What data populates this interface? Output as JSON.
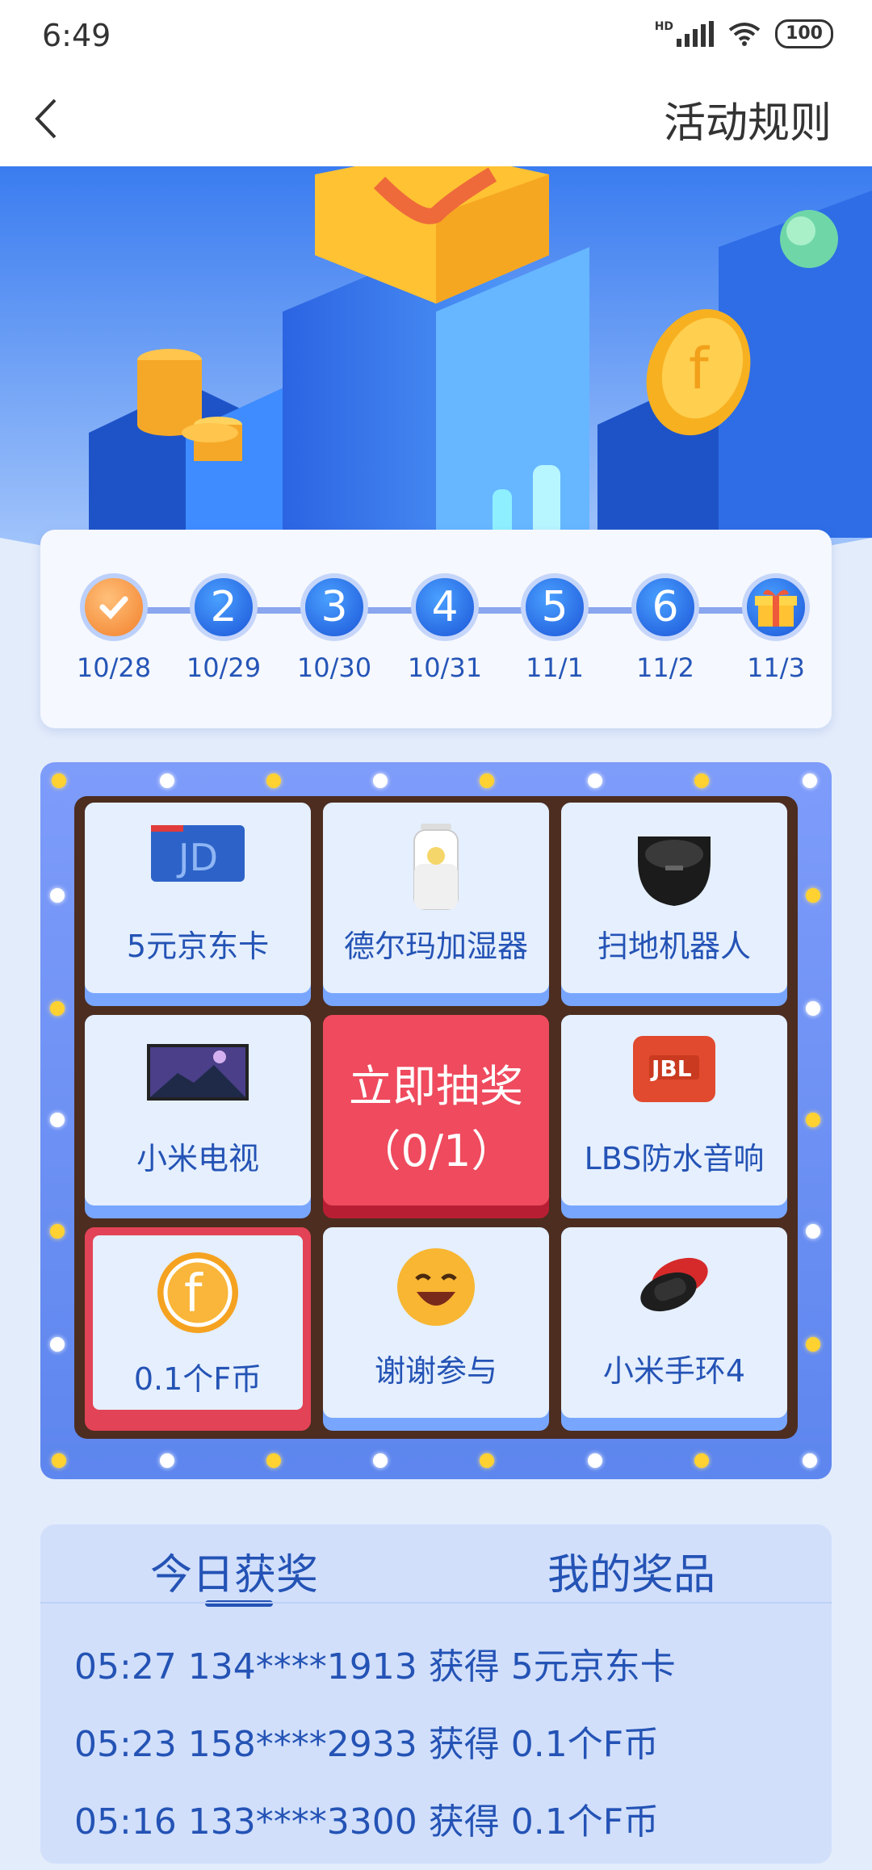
{
  "status_bar": {
    "time": "6:49",
    "battery": "100",
    "network": "HD"
  },
  "header": {
    "rules_link": "活动规则"
  },
  "checkin": {
    "days": [
      {
        "label": "",
        "date": "10/28",
        "state": "checked"
      },
      {
        "label": "2",
        "date": "10/29",
        "state": "pending"
      },
      {
        "label": "3",
        "date": "10/30",
        "state": "pending"
      },
      {
        "label": "4",
        "date": "10/31",
        "state": "pending"
      },
      {
        "label": "5",
        "date": "11/1",
        "state": "pending"
      },
      {
        "label": "6",
        "date": "11/2",
        "state": "pending"
      },
      {
        "label": "",
        "date": "11/3",
        "state": "gift"
      }
    ]
  },
  "lottery": {
    "prizes": [
      {
        "label": "5元京东卡",
        "icon": "jd-card-icon"
      },
      {
        "label": "德尔玛加湿器",
        "icon": "humidifier-icon"
      },
      {
        "label": "扫地机器人",
        "icon": "robot-vacuum-icon"
      },
      {
        "label": "小米电视",
        "icon": "tv-icon"
      },
      {
        "label": "LBS防水音响",
        "icon": "jbl-speaker-icon"
      },
      {
        "label": "0.1个F币",
        "icon": "f-coin-icon",
        "highlighted": true
      },
      {
        "label": "谢谢参与",
        "icon": "smile-face-icon"
      },
      {
        "label": "小米手环4",
        "icon": "mi-band-icon"
      }
    ],
    "draw_button": {
      "title": "立即抽奖",
      "count": "（0/1）"
    }
  },
  "winners": {
    "tabs": [
      "今日获奖",
      "我的奖品"
    ],
    "active_tab": 0,
    "rows": [
      "05:27 134****1913 获得 5元京东卡",
      "05:23 158****2933 获得 0.1个F币",
      "05:16 133****3300 获得 0.1个F币"
    ]
  },
  "colors": {
    "brand_blue": "#2453b5",
    "draw_red": "#ef4a5e",
    "board_blue": "#6f92f6"
  }
}
